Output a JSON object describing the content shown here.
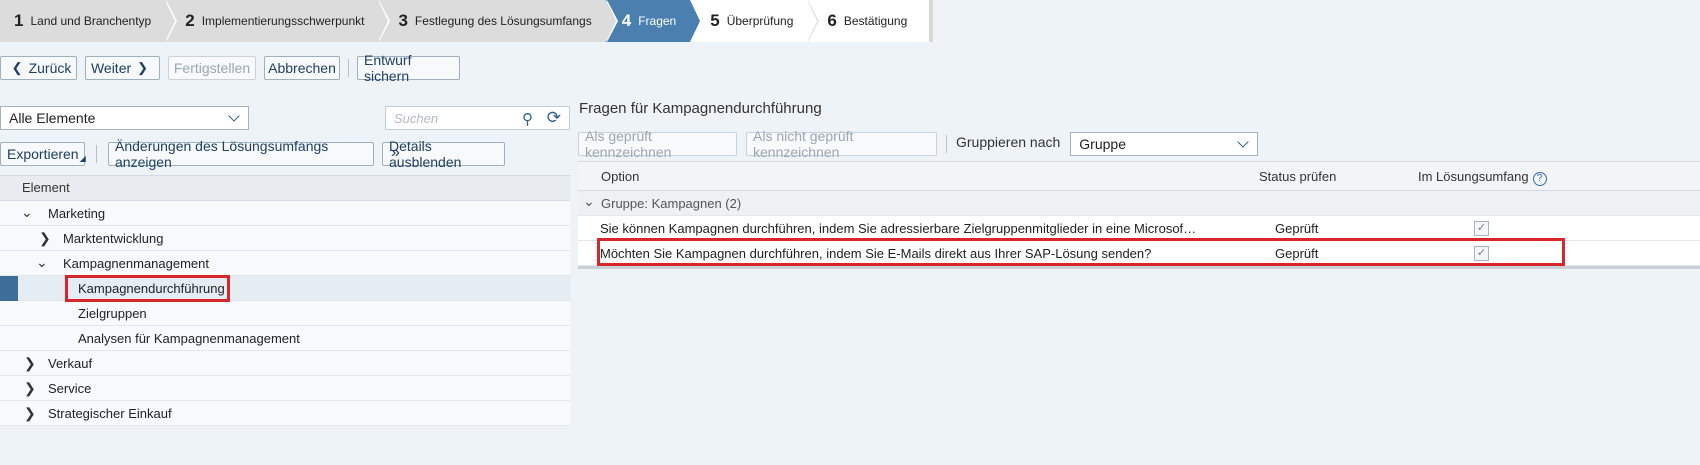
{
  "wizard": {
    "steps": [
      {
        "num": "1",
        "label": "Land und Branchentyp"
      },
      {
        "num": "2",
        "label": "Implementierungsschwerpunkt"
      },
      {
        "num": "3",
        "label": "Festlegung des Lösungsumfangs"
      },
      {
        "num": "4",
        "label": "Fragen"
      },
      {
        "num": "5",
        "label": "Überprüfung"
      },
      {
        "num": "6",
        "label": "Bestätigung"
      }
    ],
    "active_step": 4
  },
  "toolbar": {
    "back": "Zurück",
    "next": "Weiter",
    "finish": "Fertigstellen",
    "cancel": "Abbrechen",
    "save_draft": "Entwurf sichern"
  },
  "left": {
    "filter_value": "Alle Elemente",
    "search_placeholder": "Suchen",
    "export": "Exportieren",
    "show_changes": "Änderungen des Lösungsumfangs anzeigen",
    "hide_details": "Details ausblenden",
    "column_header": "Element",
    "tree": [
      {
        "label": "Marketing",
        "toggle": "collapse"
      },
      {
        "label": "Marktentwicklung",
        "toggle": "expand"
      },
      {
        "label": "Kampagnenmanagement",
        "toggle": "collapse"
      },
      {
        "label": "Kampagnendurchführung",
        "toggle": "none",
        "selected": true
      },
      {
        "label": "Zielgruppen",
        "toggle": "none"
      },
      {
        "label": "Analysen für Kampagnenmanagement",
        "toggle": "none"
      },
      {
        "label": "Verkauf",
        "toggle": "expand"
      },
      {
        "label": "Service",
        "toggle": "expand"
      },
      {
        "label": "Strategischer Einkauf",
        "toggle": "expand"
      }
    ]
  },
  "right": {
    "title": "Fragen für Kampagnendurchführung",
    "mark_checked": "Als geprüft kennzeichnen",
    "mark_unchecked": "Als nicht geprüft kennzeichnen",
    "group_by_label": "Gruppieren nach",
    "group_by_value": "Gruppe",
    "columns": {
      "option": "Option",
      "status": "Status prüfen",
      "scope": "Im Lösungsumfang"
    },
    "group_row": "Gruppe: Kampagnen (2)",
    "rows": [
      {
        "option": "Sie können Kampagnen durchführen, indem Sie adressierbare Zielgruppenmitglieder in eine Microsof…",
        "status": "Geprüft",
        "in_scope": true
      },
      {
        "option": "Möchten Sie Kampagnen durchführen, indem Sie E-Mails direkt aus Ihrer SAP-Lösung senden?",
        "status": "Geprüft",
        "in_scope": true
      }
    ]
  },
  "colors": {
    "accent": "#4a7fb0",
    "highlight": "#d9262b",
    "selection_bar": "#3e6d99"
  }
}
